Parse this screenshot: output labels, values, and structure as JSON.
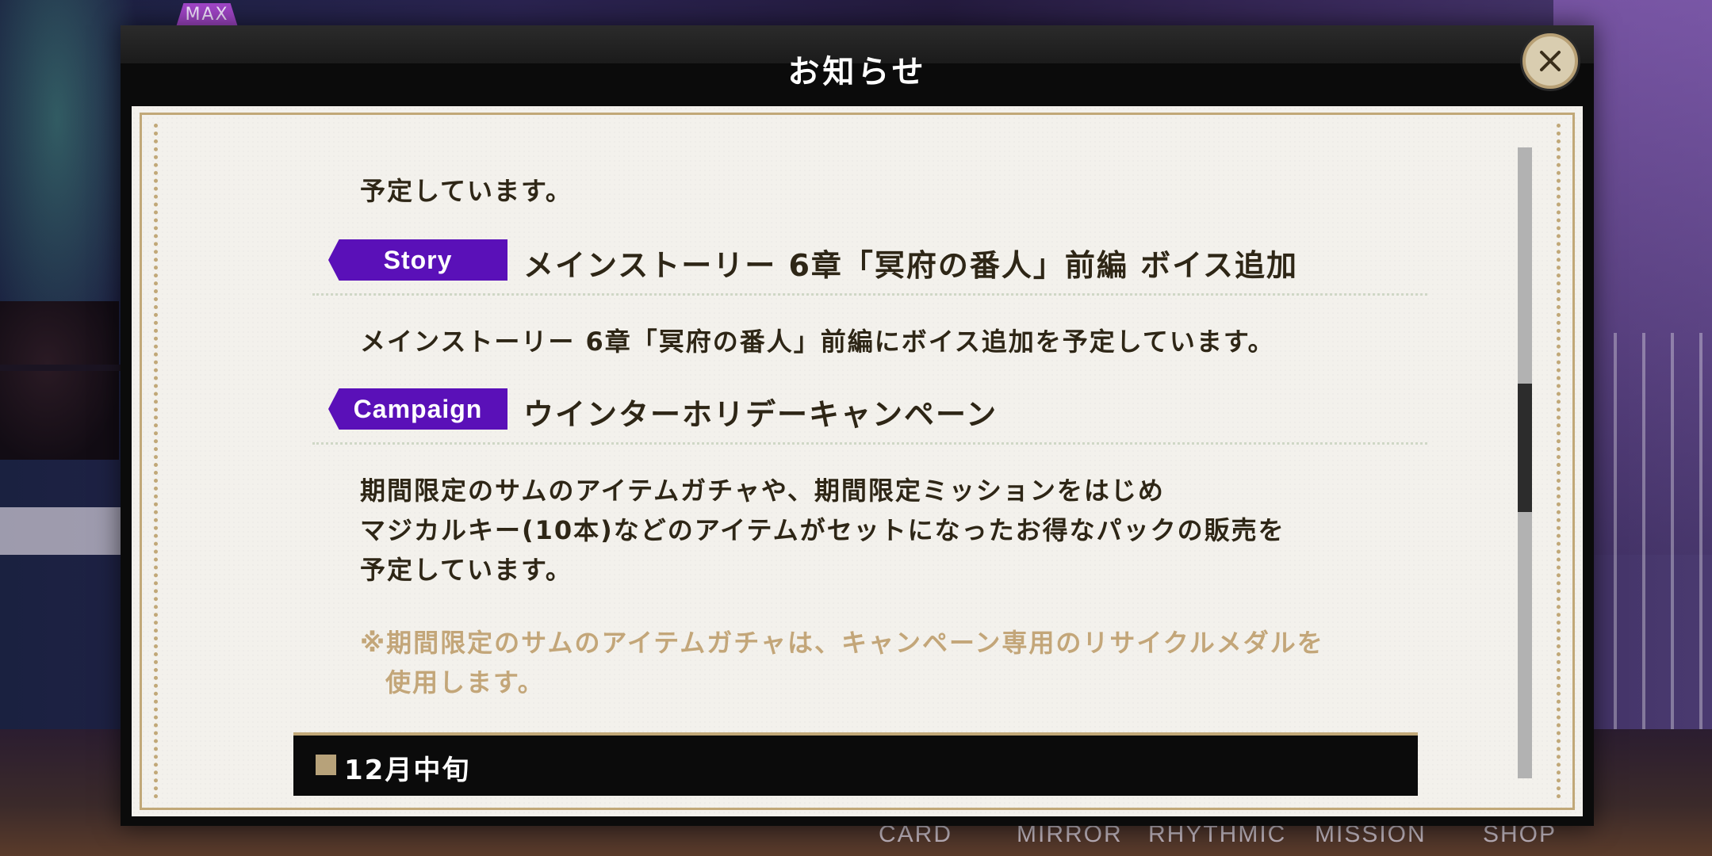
{
  "background": {
    "badge": "MAX",
    "nav_items": [
      "CARD",
      "MIRROR",
      "RHYTHMIC",
      "MISSION",
      "SHOP"
    ]
  },
  "modal": {
    "title": "お知らせ",
    "close_icon": "close-icon"
  },
  "content": {
    "intro_line": "予定しています。",
    "sections": [
      {
        "tag": "Story",
        "heading": "メインストーリー 6章「冥府の番人」前編 ボイス追加",
        "body": [
          "メインストーリー 6章「冥府の番人」前編にボイス追加を予定しています。"
        ]
      },
      {
        "tag": "Campaign",
        "heading": "ウインターホリデーキャンペーン",
        "body": [
          "期間限定のサムのアイテムガチャや、期間限定ミッションをはじめ",
          "マジカルキー(10本)などのアイテムがセットになったお得なパックの販売を",
          "予定しています。"
        ],
        "note": [
          "※期間限定のサムのアイテムガチャは、キャンペーン専用のリサイクルメダルを",
          "使用します。"
        ]
      }
    ],
    "date_header": "12月中旬"
  },
  "colors": {
    "tag_purple": "#5a10b8",
    "gold": "#c1a878",
    "paper": "#f3f1ec",
    "note_text": "#c3a679"
  }
}
